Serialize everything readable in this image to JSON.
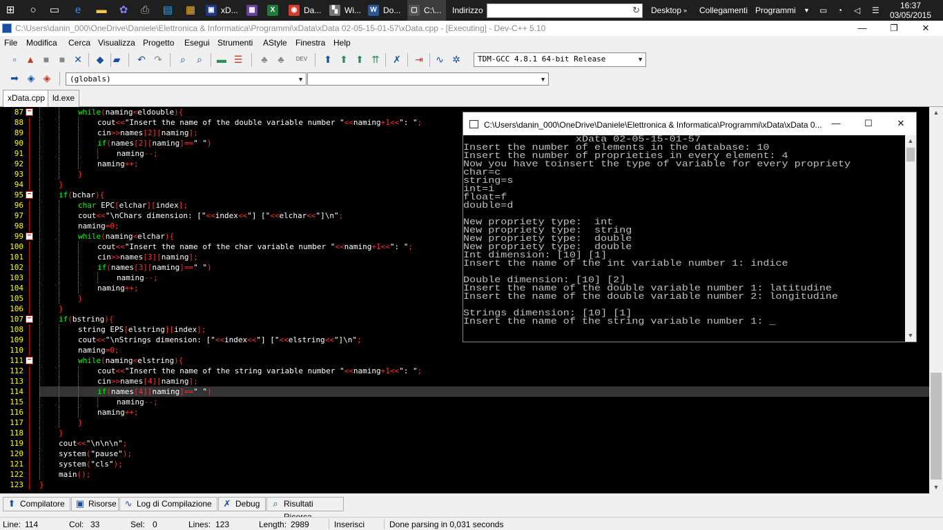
{
  "taskbar": {
    "apps": [
      {
        "label": "xD...",
        "color": "#1d3a8a",
        "glyph": "▣"
      },
      {
        "label": "",
        "color": "#6a3fa0",
        "glyph": "▦"
      },
      {
        "label": "",
        "color": "#1e7b3a",
        "glyph": "X"
      },
      {
        "label": "Da...",
        "color": "#d33b2c",
        "glyph": "◉"
      },
      {
        "label": "Wi...",
        "color": "#777777",
        "glyph": "▚"
      },
      {
        "label": "Do...",
        "color": "#2b5797",
        "glyph": "W"
      },
      {
        "label": "C:\\...",
        "color": "#555555",
        "glyph": "▢"
      }
    ],
    "address_label": "Indirizzo",
    "desktop_label": "Desktop",
    "links_label": "Collegamenti",
    "programs_label": "Programmi",
    "time": "16:37",
    "date": "03/05/2015"
  },
  "window": {
    "title": "C:\\Users\\danin_000\\OneDrive\\Daniele\\Elettronica & Informatica\\Programmi\\xData\\xData 02-05-15-01-57\\xData.cpp - [Executing] - Dev-C++ 5.10"
  },
  "menu": [
    "File",
    "Modifica",
    "Cerca",
    "Visualizza",
    "Progetto",
    "Esegui",
    "Strumenti",
    "AStyle",
    "Finestra",
    "Help"
  ],
  "toolbar": {
    "compiler": "TDM-GCC 4.8.1 64-bit Release",
    "scope": "(globals)",
    "function": ""
  },
  "tabs": [
    "xData.cpp",
    "ld.exe"
  ],
  "editor": {
    "current_line": 114,
    "lines": [
      {
        "n": 87,
        "indent": 2,
        "fold": true,
        "html": "<span class='k'>while</span><span class='o'>(</span>naming<span class='o'>&lt;</span>eldouble<span class='o'>){</span>"
      },
      {
        "n": 88,
        "indent": 3,
        "html": "cout<span class='o'>&lt;&lt;</span>\"Insert the name of the double variable number \"<span class='o'>&lt;&lt;</span>naming<span class='o'>+</span><span class='n'>1</span><span class='o'>&lt;&lt;</span>\": \"<span class='o'>;</span>"
      },
      {
        "n": 89,
        "indent": 3,
        "html": "cin<span class='o'>&gt;&gt;</span>names<span class='o'>[</span><span class='n'>2</span><span class='o'>][</span>naming<span class='o'>];</span>"
      },
      {
        "n": 90,
        "indent": 3,
        "html": "<span class='k'>if</span><span class='o'>(</span>names<span class='o'>[</span><span class='n'>2</span><span class='o'>][</span>naming<span class='o'>]==</span>\" \"<span class='o'>)</span>"
      },
      {
        "n": 91,
        "indent": 4,
        "html": "naming<span class='o'>--;</span>"
      },
      {
        "n": 92,
        "indent": 3,
        "html": "naming<span class='o'>++;</span>"
      },
      {
        "n": 93,
        "indent": 2,
        "html": "<span class='o'>}</span>"
      },
      {
        "n": 94,
        "indent": 1,
        "html": "<span class='o'>}</span>"
      },
      {
        "n": 95,
        "indent": 1,
        "fold": true,
        "html": "<span class='k'>if</span><span class='o'>(</span>bchar<span class='o'>){</span>"
      },
      {
        "n": 96,
        "indent": 2,
        "html": "<span class='t'>char</span> EPC<span class='o'>[</span>elchar<span class='o'>][</span>index<span class='o'>];</span>"
      },
      {
        "n": 97,
        "indent": 2,
        "html": "cout<span class='o'>&lt;&lt;</span>\"\\nChars dimension: [\"<span class='o'>&lt;&lt;</span>index<span class='o'>&lt;&lt;</span>\"] [\"<span class='o'>&lt;&lt;</span>elchar<span class='o'>&lt;&lt;</span>\"]\\n\"<span class='o'>;</span>"
      },
      {
        "n": 98,
        "indent": 2,
        "html": "naming<span class='o'>=</span><span class='n'>0</span><span class='o'>;</span>"
      },
      {
        "n": 99,
        "indent": 2,
        "fold": true,
        "html": "<span class='k'>while</span><span class='o'>(</span>naming<span class='o'>&lt;</span>elchar<span class='o'>){</span>"
      },
      {
        "n": 100,
        "indent": 3,
        "html": "cout<span class='o'>&lt;&lt;</span>\"Insert the name of the char variable number \"<span class='o'>&lt;&lt;</span>naming<span class='o'>+</span><span class='n'>1</span><span class='o'>&lt;&lt;</span>\": \"<span class='o'>;</span>"
      },
      {
        "n": 101,
        "indent": 3,
        "html": "cin<span class='o'>&gt;&gt;</span>names<span class='o'>[</span><span class='n'>3</span><span class='o'>][</span>naming<span class='o'>];</span>"
      },
      {
        "n": 102,
        "indent": 3,
        "html": "<span class='k'>if</span><span class='o'>(</span>names<span class='o'>[</span><span class='n'>3</span><span class='o'>][</span>naming<span class='o'>]==</span>\" \"<span class='o'>)</span>"
      },
      {
        "n": 103,
        "indent": 4,
        "html": "naming<span class='o'>--;</span>"
      },
      {
        "n": 104,
        "indent": 3,
        "html": "naming<span class='o'>++;</span>"
      },
      {
        "n": 105,
        "indent": 2,
        "html": "<span class='o'>}</span>"
      },
      {
        "n": 106,
        "indent": 1,
        "html": "<span class='o'>}</span>"
      },
      {
        "n": 107,
        "indent": 1,
        "fold": true,
        "html": "<span class='k'>if</span><span class='o'>(</span>bstring<span class='o'>){</span>"
      },
      {
        "n": 108,
        "indent": 2,
        "html": "string EPS<span class='o'>[</span>elstring<span class='o'>][</span>index<span class='o'>];</span>"
      },
      {
        "n": 109,
        "indent": 2,
        "html": "cout<span class='o'>&lt;&lt;</span>\"\\nStrings dimension: [\"<span class='o'>&lt;&lt;</span>index<span class='o'>&lt;&lt;</span>\"] [\"<span class='o'>&lt;&lt;</span>elstring<span class='o'>&lt;&lt;</span>\"]\\n\"<span class='o'>;</span>"
      },
      {
        "n": 110,
        "indent": 2,
        "html": "naming<span class='o'>=</span><span class='n'>0</span><span class='o'>;</span>"
      },
      {
        "n": 111,
        "indent": 2,
        "fold": true,
        "html": "<span class='k'>while</span><span class='o'>(</span>naming<span class='o'>&lt;</span>elstring<span class='o'>){</span>"
      },
      {
        "n": 112,
        "indent": 3,
        "html": "cout<span class='o'>&lt;&lt;</span>\"Insert the name of the string variable number \"<span class='o'>&lt;&lt;</span>naming<span class='o'>+</span><span class='n'>1</span><span class='o'>&lt;&lt;</span>\": \"<span class='o'>;</span>"
      },
      {
        "n": 113,
        "indent": 3,
        "html": "cin<span class='o'>&gt;&gt;</span>names<span class='o'>[</span><span class='n'>4</span><span class='o'>][</span>naming<span class='o'>];</span>"
      },
      {
        "n": 114,
        "indent": 3,
        "html": "<span class='k'>if</span><span class='o'>(</span>names<span class='o'>[</span><span class='n'>4</span><span class='o'>][</span>naming<span class='o'>]==</span>\" \"<span class='o'>)</span>"
      },
      {
        "n": 115,
        "indent": 4,
        "html": "naming<span class='o'>--;</span>"
      },
      {
        "n": 116,
        "indent": 3,
        "html": "naming<span class='o'>++;</span>"
      },
      {
        "n": 117,
        "indent": 2,
        "html": "<span class='o'>}</span>"
      },
      {
        "n": 118,
        "indent": 1,
        "html": "<span class='o'>}</span>"
      },
      {
        "n": 119,
        "indent": 1,
        "html": "cout<span class='o'>&lt;&lt;</span>\"\\n\\n\\n\"<span class='o'>;</span>"
      },
      {
        "n": 120,
        "indent": 1,
        "html": "system<span class='o'>(</span>\"pause\"<span class='o'>);</span>"
      },
      {
        "n": 121,
        "indent": 1,
        "html": "system<span class='o'>(</span>\"cls\"<span class='o'>);</span>"
      },
      {
        "n": 122,
        "indent": 1,
        "html": "main<span class='o'>();</span>"
      },
      {
        "n": 123,
        "indent": 0,
        "html": "<span class='o'>}</span>"
      }
    ]
  },
  "console": {
    "title": "C:\\Users\\danin_000\\OneDrive\\Daniele\\Elettronica & Informatica\\Programmi\\xData\\xData 0...",
    "lines": [
      "                  xData 02-05-15-01-57",
      "Insert the number of elements in the database: 10",
      "Insert the number of proprieties in every element: 4",
      "Now you have toinsert the type of variable for every propriety",
      "char=c",
      "string=s",
      "int=i",
      "float=f",
      "double=d",
      "",
      "New propriety type:  int",
      "New propriety type:  string",
      "New propriety type:  double",
      "New propriety type:  double",
      "Int dimension: [10] [1]",
      "Insert the name of the int variable number 1: indice",
      "",
      "Double dimension: [10] [2]",
      "Insert the name of the double variable number 1: latitudine",
      "Insert the name of the double variable number 2: longitudine",
      "",
      "Strings dimension: [10] [1]",
      "Insert the name of the string variable number 1: _"
    ]
  },
  "bottom_tabs": [
    "Compilatore",
    "Risorse",
    "Log di Compilazione",
    "Debug",
    "Risultati Ricerca"
  ],
  "status": {
    "line_label": "Line:",
    "line": "114",
    "col_label": "Col:",
    "col": "33",
    "sel_label": "Sel:",
    "sel": "0",
    "lines_label": "Lines:",
    "lines": "123",
    "length_label": "Length:",
    "length": "2989",
    "mode": "Inserisci",
    "message": "Done parsing in 0,031 seconds"
  }
}
